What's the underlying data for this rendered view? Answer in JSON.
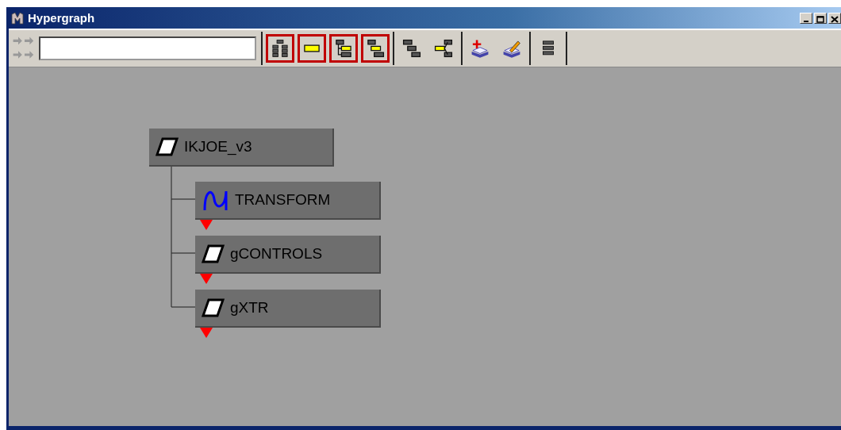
{
  "window": {
    "title": "Hypergraph"
  },
  "toolbar": {
    "groups": [
      [
        {
          "kind": "scene",
          "on": true
        },
        {
          "kind": "selected",
          "on": true
        },
        {
          "kind": "upstream",
          "on": true
        },
        {
          "kind": "downstream",
          "on": true
        }
      ],
      [
        {
          "kind": "hierarchy",
          "on": false
        },
        {
          "kind": "input-output",
          "on": false
        }
      ],
      [
        {
          "kind": "bookmark-add",
          "on": false
        },
        {
          "kind": "bookmark-edit",
          "on": false
        }
      ],
      [
        {
          "kind": "list",
          "on": false
        }
      ]
    ]
  },
  "graph": {
    "root": {
      "label": "IKJOE_v3",
      "kind": "group",
      "collapsed": false,
      "children": [
        {
          "label": "TRANSFORM",
          "kind": "curve",
          "collapsed": true
        },
        {
          "label": "gCONTROLS",
          "kind": "group",
          "collapsed": true
        },
        {
          "label": "gXTR",
          "kind": "group",
          "collapsed": true
        }
      ]
    }
  }
}
